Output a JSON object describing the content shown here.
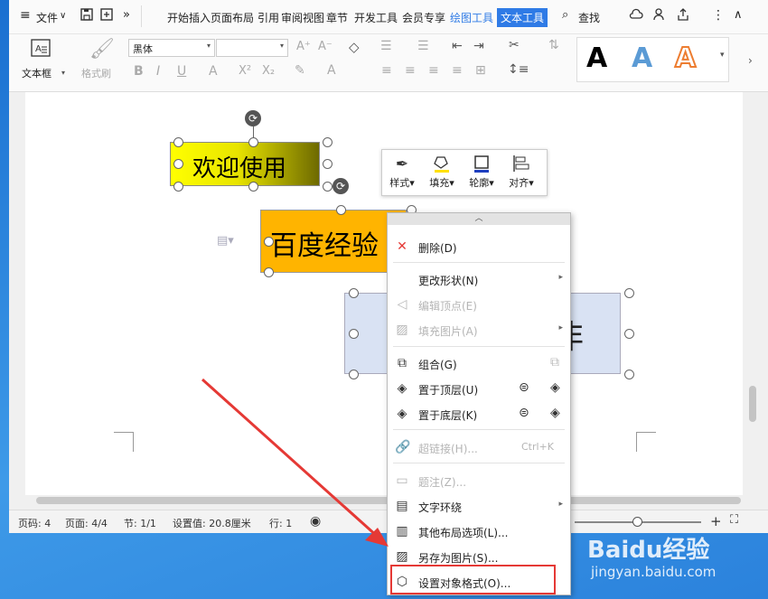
{
  "menubar": {
    "file": "文件",
    "tabs": [
      "开始",
      "插入",
      "页面布局",
      "引用",
      "审阅",
      "视图",
      "章节",
      "开发工具",
      "会员专享",
      "绘图工具",
      "文本工具"
    ],
    "search": "查找"
  },
  "ribbon": {
    "textbox_label": "文本框",
    "format_painter": "格式刷",
    "font_name": "黑体",
    "font_size": "",
    "style_letters": [
      "A",
      "A",
      "A"
    ]
  },
  "canvas": {
    "box1_text": "欢迎使用",
    "box2_text": "百度经验",
    "box3_text": "非"
  },
  "mini_toolbar": {
    "items": [
      "样式",
      "填充",
      "轮廓",
      "对齐"
    ]
  },
  "context_menu": {
    "items": [
      {
        "label": "删除(D)",
        "enabled": true
      },
      {
        "label": "更改形状(N)",
        "enabled": true
      },
      {
        "label": "编辑顶点(E)",
        "enabled": false
      },
      {
        "label": "填充图片(A)",
        "enabled": false
      },
      {
        "label": "组合(G)",
        "enabled": true
      },
      {
        "label": "置于顶层(U)",
        "enabled": true
      },
      {
        "label": "置于底层(K)",
        "enabled": true
      },
      {
        "label": "超链接(H)...",
        "enabled": false,
        "shortcut": "Ctrl+K"
      },
      {
        "label": "题注(Z)...",
        "enabled": false
      },
      {
        "label": "文字环绕",
        "enabled": true
      },
      {
        "label": "其他布局选项(L)...",
        "enabled": true
      },
      {
        "label": "另存为图片(S)...",
        "enabled": true
      },
      {
        "label": "设置对象格式(O)...",
        "enabled": true
      }
    ]
  },
  "status": {
    "page_no": "页码: 4",
    "pages": "页面: 4/4",
    "section": "节: 1/1",
    "setting": "设置值: 20.8厘米",
    "row": "行: 1"
  },
  "watermark": {
    "brand": "Baidu经验",
    "url": "jingyan.baidu.com"
  },
  "colors": {
    "accent": "#2f7be6",
    "highlight_border": "#e53935",
    "arrow": "#e53935"
  }
}
